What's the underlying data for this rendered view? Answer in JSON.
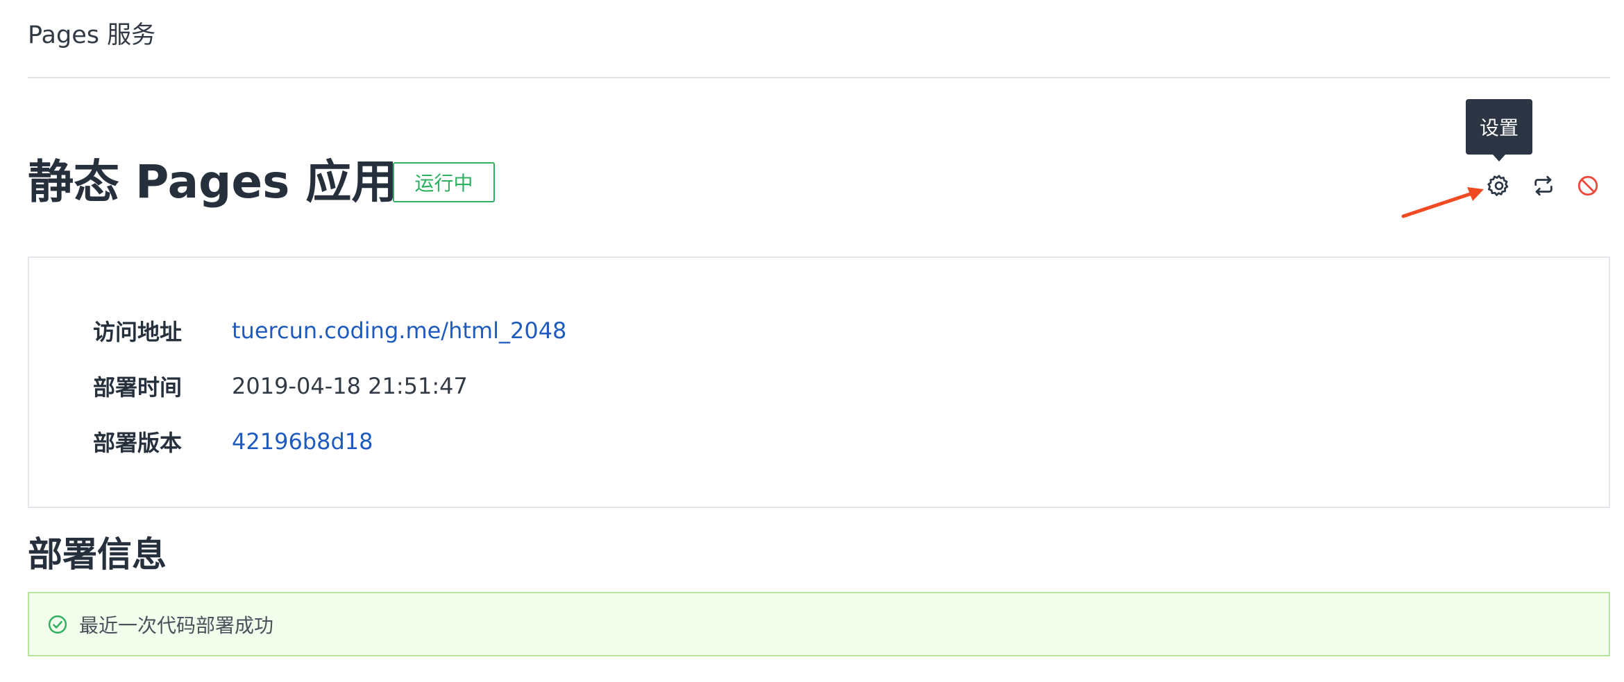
{
  "header": {
    "service_title": "Pages 服务"
  },
  "app": {
    "title": "静态 Pages 应用",
    "status": "运行中"
  },
  "toolbar": {
    "tooltip": "设置",
    "icons": [
      "gear-icon",
      "repeat-icon",
      "stop-icon"
    ],
    "colors": {
      "icon": "#2b3544",
      "danger": "#f0463c",
      "annotation": "#f04a23"
    }
  },
  "info": {
    "rows": [
      {
        "label": "访问地址",
        "value": "tuercun.coding.me/html_2048"
      },
      {
        "label": "部署时间",
        "value": "2019-04-18 21:51:47"
      },
      {
        "label": "部署版本",
        "value": "42196b8d18"
      }
    ]
  },
  "deploy": {
    "section_title": "部署信息",
    "message": "最近一次代码部署成功"
  },
  "colors": {
    "success": "#2fb060",
    "link": "#1f5bbf",
    "alert_bg": "#f3fdec",
    "alert_border": "#b7e59c"
  }
}
